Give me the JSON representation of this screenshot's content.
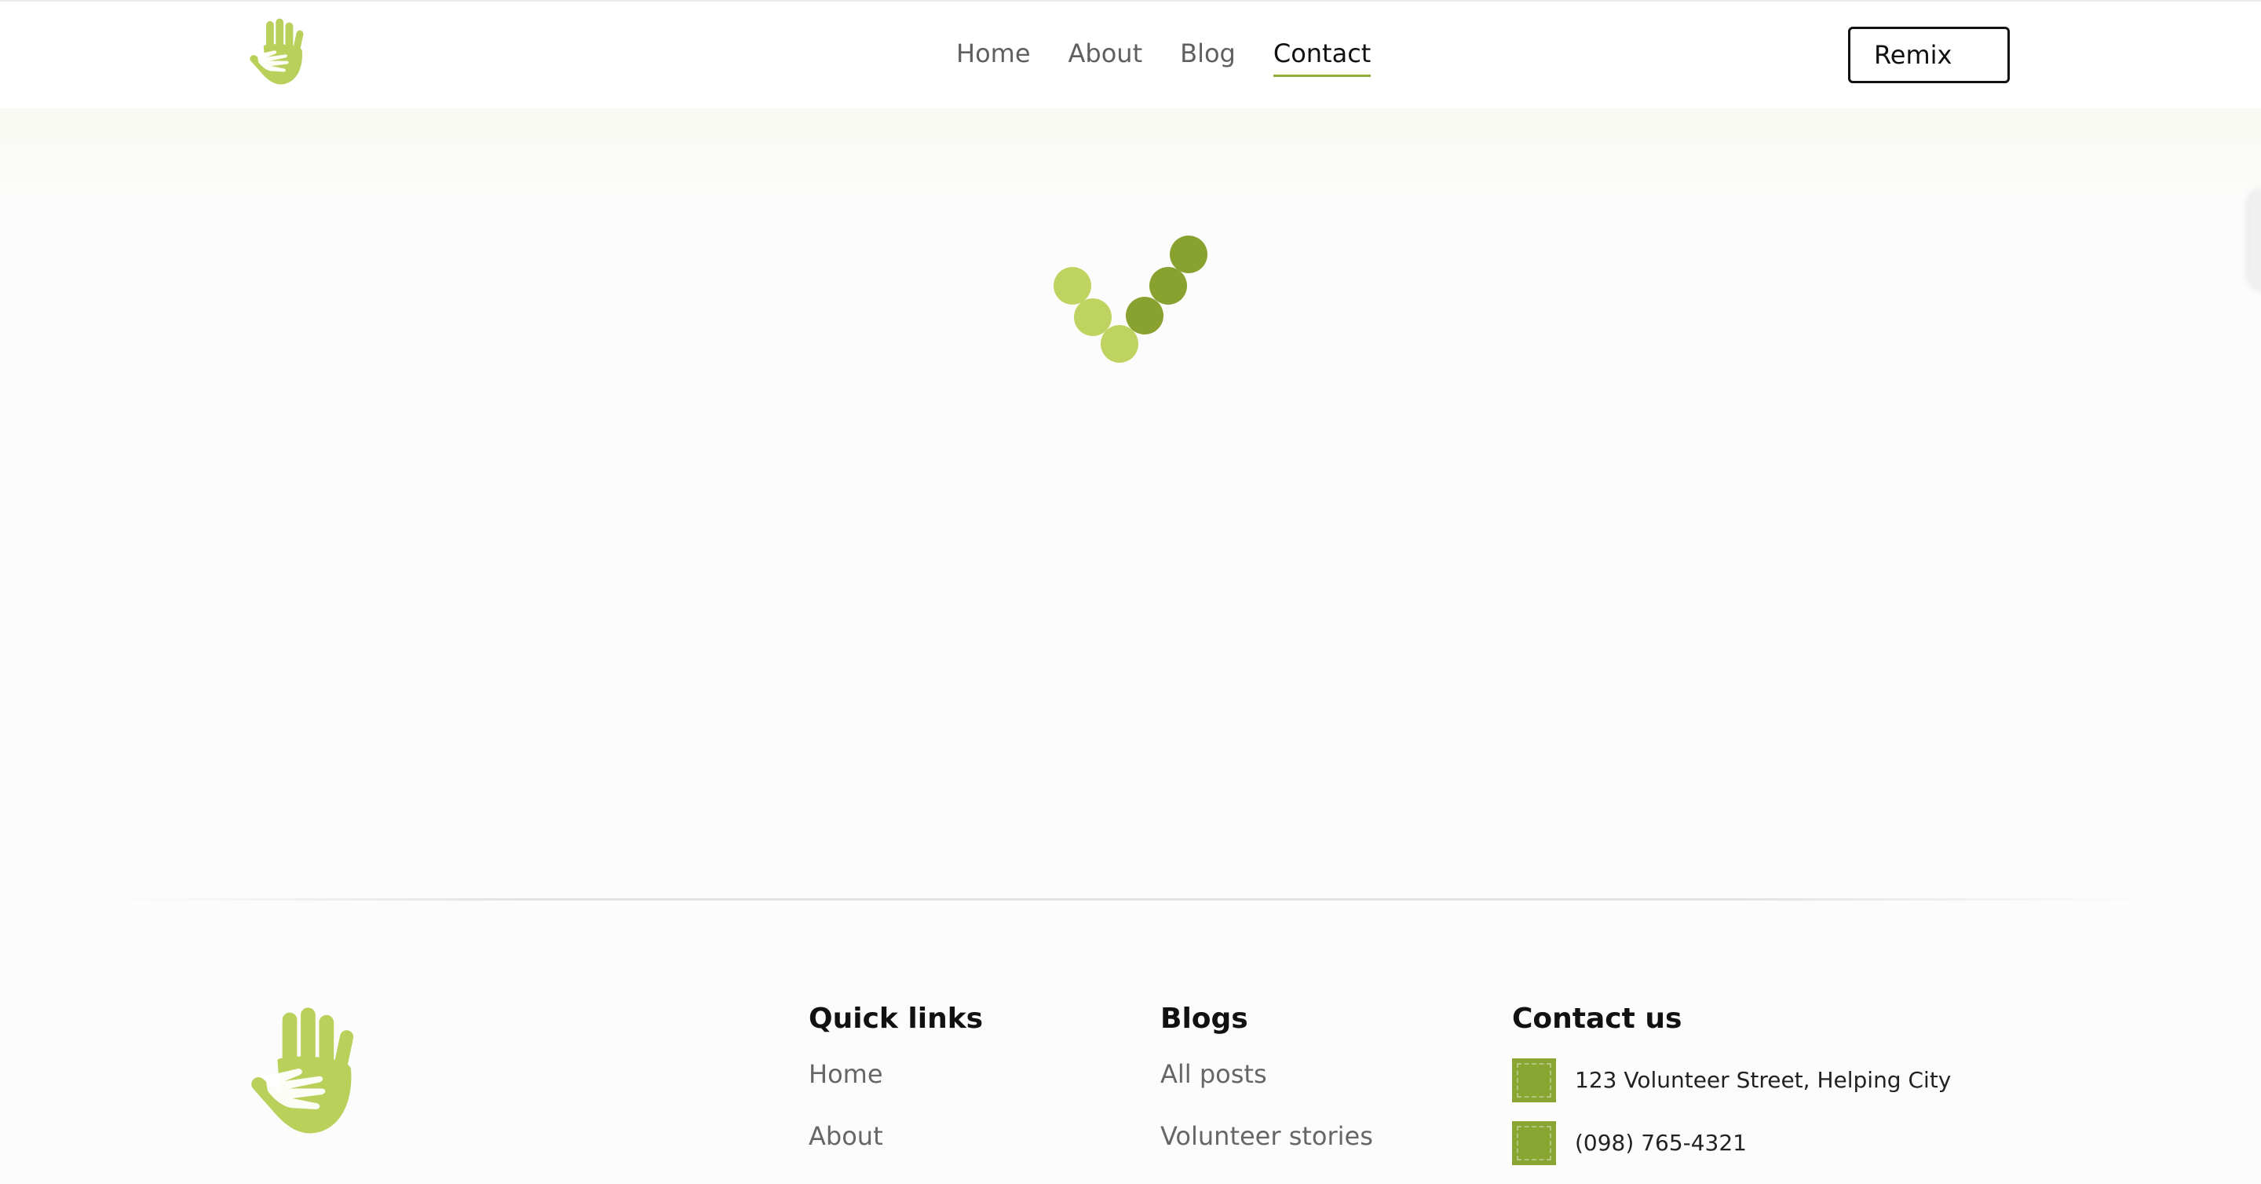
{
  "header": {
    "nav": [
      {
        "label": "Home",
        "active": false
      },
      {
        "label": "About",
        "active": false
      },
      {
        "label": "Blog",
        "active": false
      },
      {
        "label": "Contact",
        "active": true
      }
    ],
    "remix_label": "Remix"
  },
  "colors": {
    "accent": "#93ad3a",
    "dot_light": "#bfd460",
    "dot_dark": "#88a12f",
    "logo_green": "#b9d05a"
  },
  "footer": {
    "quick_links": {
      "title": "Quick links",
      "items": [
        "Home",
        "About"
      ]
    },
    "blogs": {
      "title": "Blogs",
      "items": [
        "All posts",
        "Volunteer stories"
      ]
    },
    "contact": {
      "title": "Contact us",
      "items": [
        {
          "icon": "location-icon",
          "text": "123 Volunteer Street, Helping City"
        },
        {
          "icon": "phone-icon",
          "text": "(098) 765-4321"
        }
      ]
    }
  }
}
